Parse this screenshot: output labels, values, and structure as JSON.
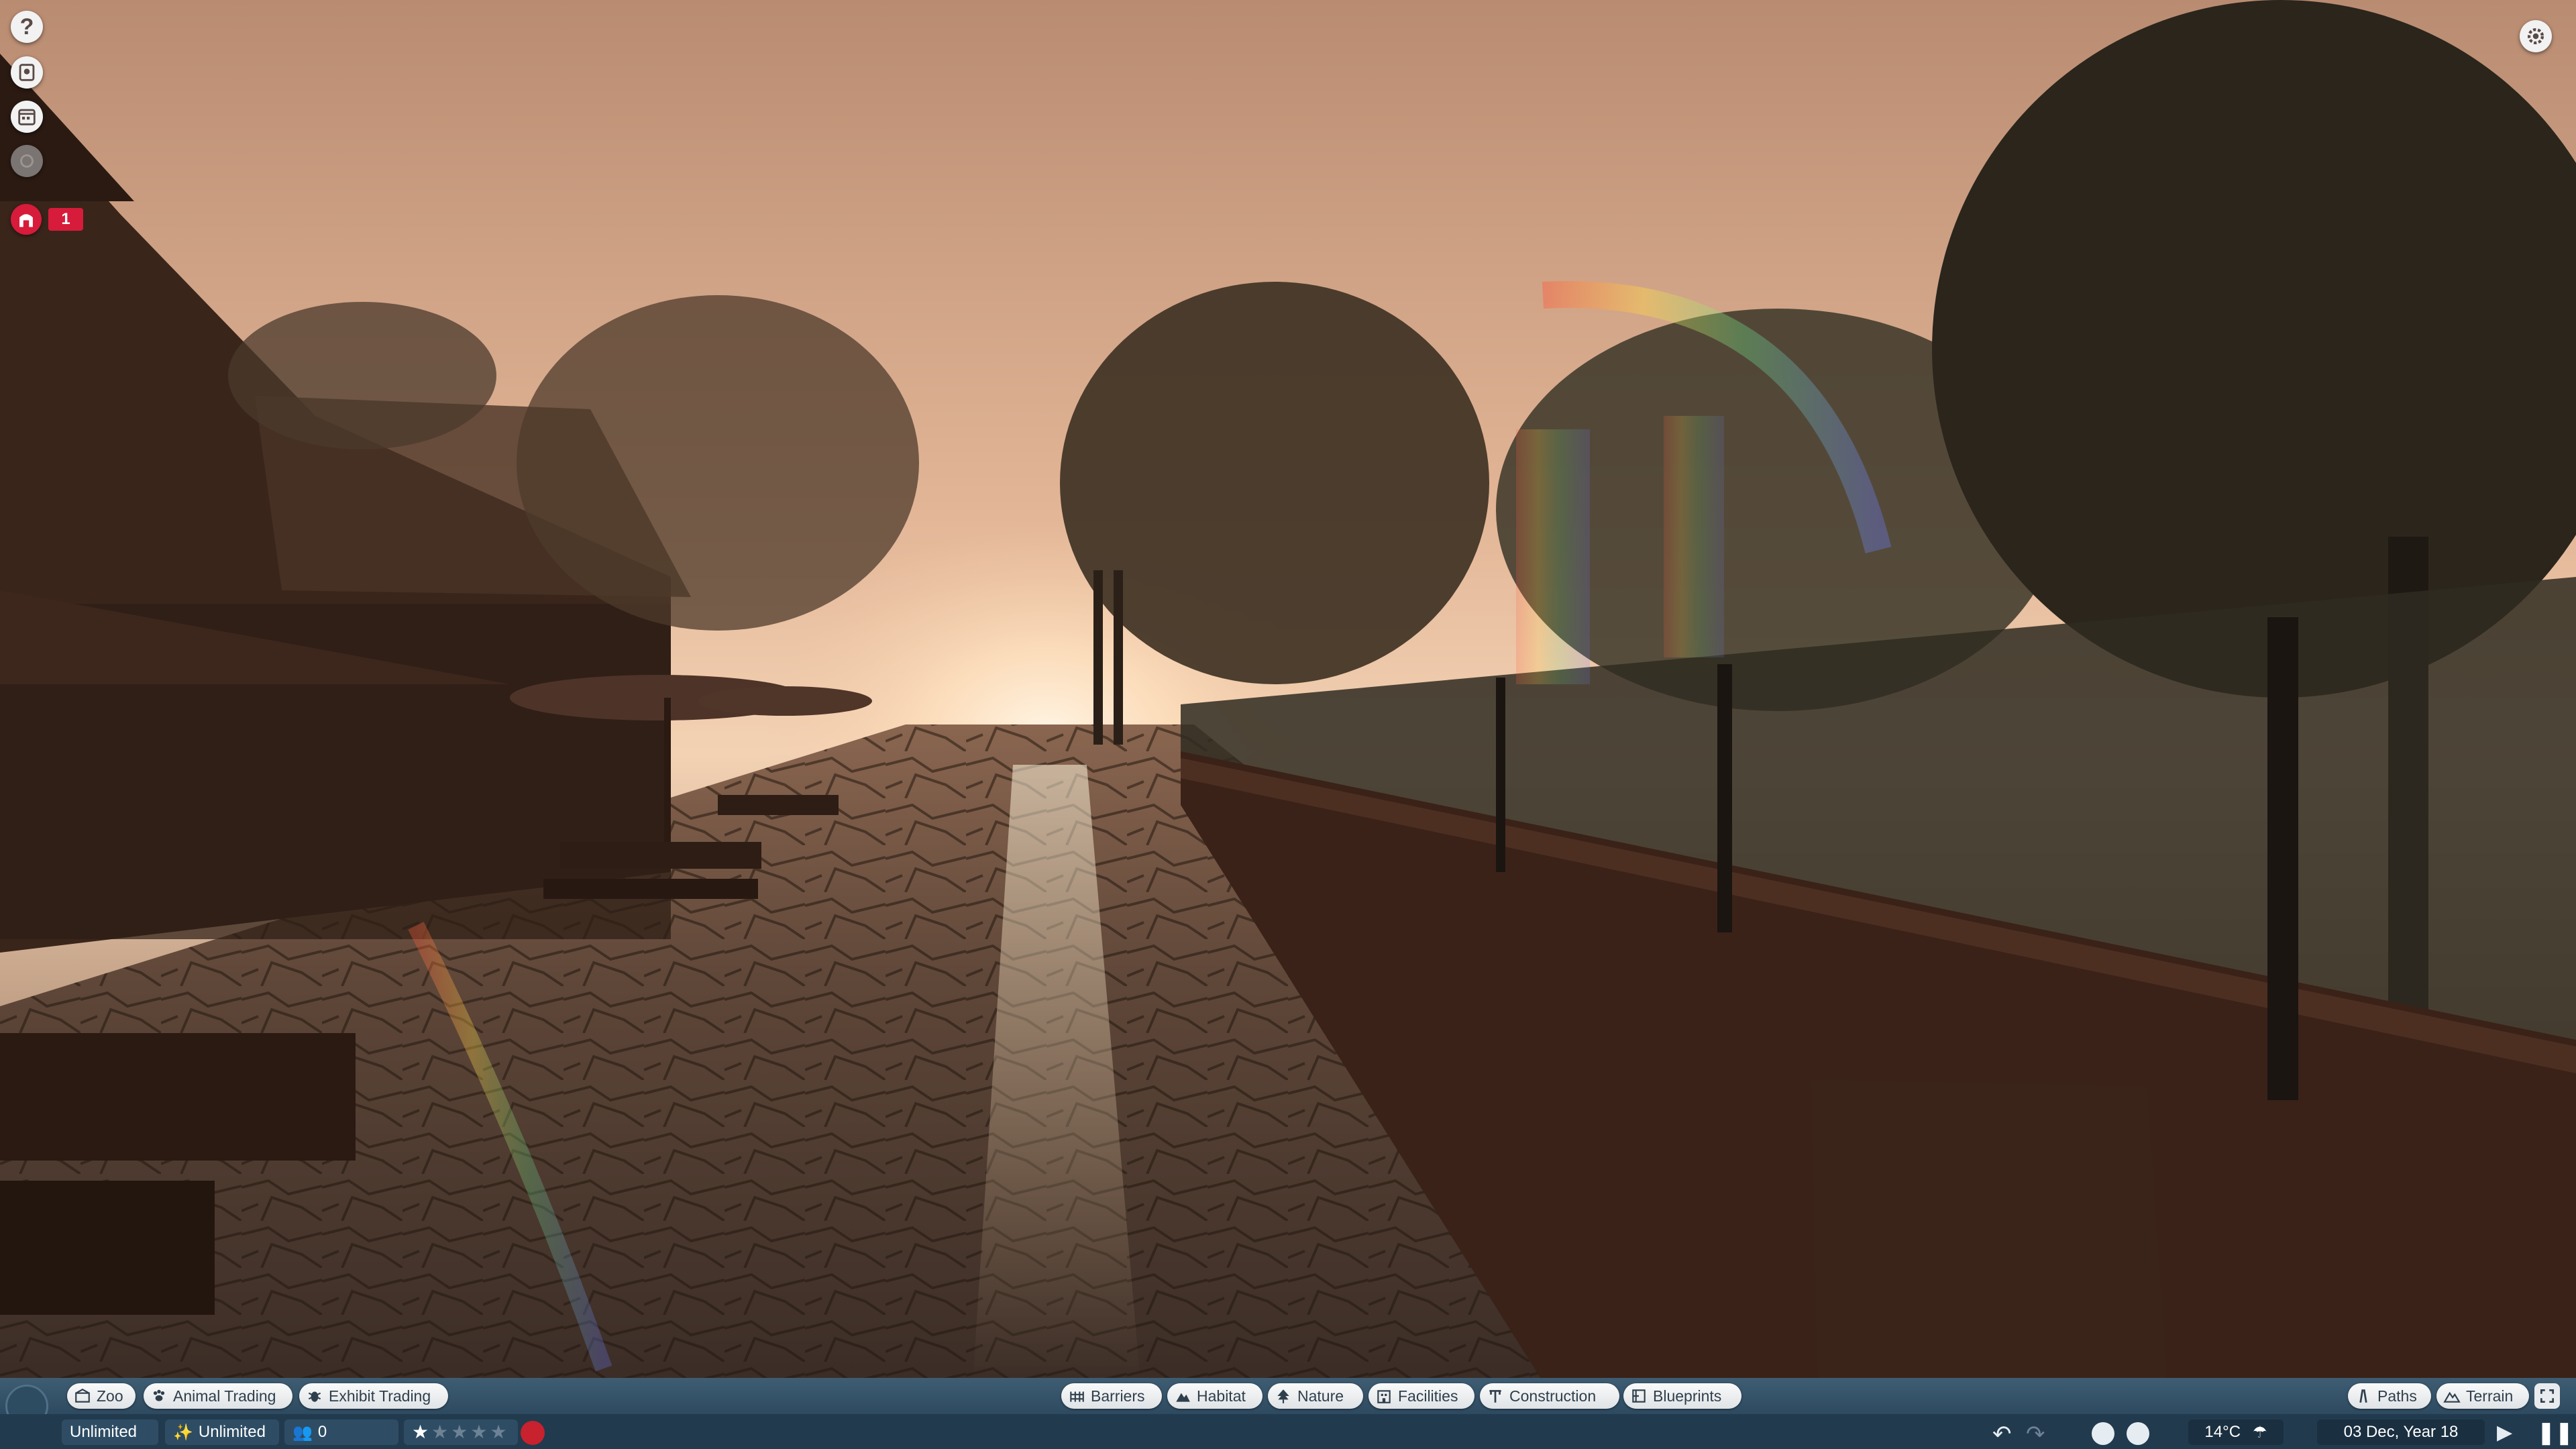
{
  "hud": {
    "help_glyph": "?",
    "notification_count": "1",
    "icons": [
      "help-icon",
      "zoopedia-icon",
      "calendar-icon",
      "disabled-icon",
      "staff-alert-icon",
      "settings-gear-icon"
    ]
  },
  "toolbar": {
    "left": [
      {
        "label": "Zoo",
        "icon": "zoo-icon"
      },
      {
        "label": "Animal Trading",
        "icon": "paw-icon"
      },
      {
        "label": "Exhibit Trading",
        "icon": "bug-icon"
      }
    ],
    "center": [
      {
        "label": "Barriers",
        "icon": "fence-icon"
      },
      {
        "label": "Habitat",
        "icon": "habitat-icon"
      },
      {
        "label": "Nature",
        "icon": "tree-icon"
      },
      {
        "label": "Facilities",
        "icon": "building-icon"
      },
      {
        "label": "Construction",
        "icon": "construction-icon"
      },
      {
        "label": "Blueprints",
        "icon": "blueprint-icon"
      }
    ],
    "right": [
      {
        "label": "Paths",
        "icon": "path-icon"
      },
      {
        "label": "Terrain",
        "icon": "mountain-icon"
      }
    ]
  },
  "status": {
    "money": "Unlimited",
    "research": "Unlimited",
    "guests": "0",
    "rating_stars": 1,
    "rating_max": 5,
    "temperature": "14°C",
    "weather": "rain-icon",
    "date": "03 Dec, Year 18"
  },
  "colors": {
    "toolbar": "#3e5c72",
    "statusbar": "#223a4e",
    "alert": "#d71b3b",
    "mood_face": "#c7222e"
  }
}
